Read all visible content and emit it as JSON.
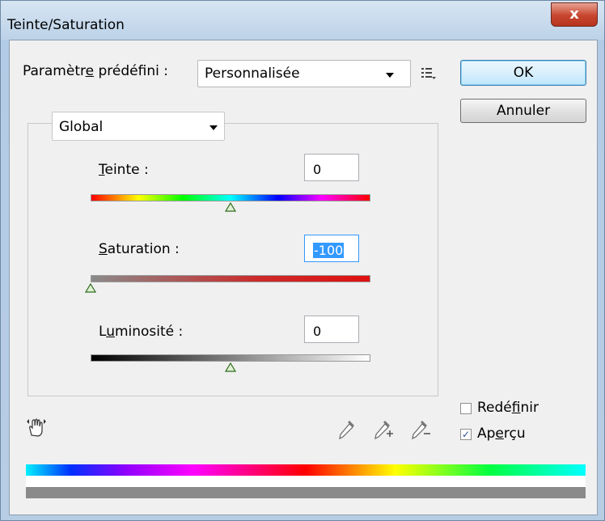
{
  "window": {
    "title": "Teinte/Saturation",
    "close_symbol": "x"
  },
  "preset": {
    "label_pre": "Paramètr",
    "label_u": "e",
    "label_post": " prédéfini :",
    "value": "Personnalisée"
  },
  "buttons": {
    "ok": "OK",
    "cancel": "Annuler"
  },
  "channel": {
    "value": "Global"
  },
  "hue": {
    "label_u": "T",
    "label_post": "einte :",
    "value": "0",
    "position": 0.5
  },
  "saturation": {
    "label_u": "S",
    "label_post": "aturation :",
    "value": "-100",
    "position": 0.0
  },
  "lightness": {
    "label_pre": "L",
    "label_u": "u",
    "label_post": "minosité :",
    "value": "0",
    "position": 0.5
  },
  "options": {
    "colorize": {
      "label_pre": "Redé",
      "label_u": "f",
      "label_post": "inir",
      "checked": false
    },
    "preview": {
      "label_pre": "Ap",
      "label_u": "e",
      "label_post": "rçu",
      "checked": true
    }
  },
  "colors": {
    "accent": "#3399ff",
    "close": "#c7452d"
  }
}
